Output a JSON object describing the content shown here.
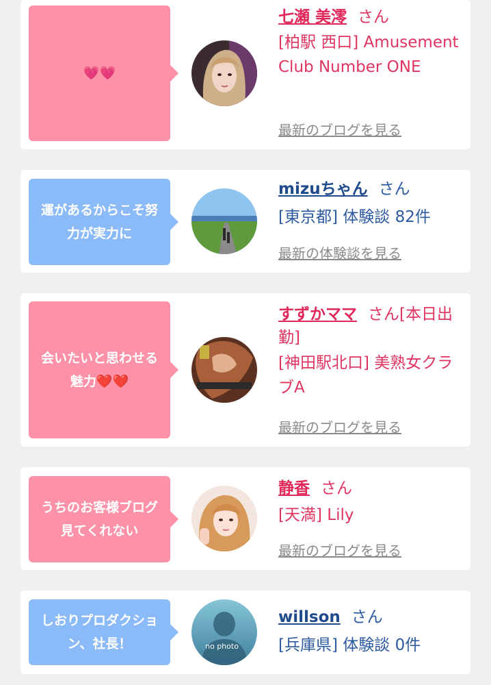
{
  "cards": [
    {
      "bubble_text": "💗💗",
      "name": "七瀬 美澪",
      "honorific": "さん",
      "shop": "[柏駅 西口] Amusement Club Number ONE",
      "link": "最新のブログを見る",
      "color": "pink"
    },
    {
      "bubble_text": "運があるからこそ努力が実力に",
      "name": "mizuちゃん",
      "honorific": "さん",
      "shop": "[東京都] 体験談 82件",
      "link": "最新の体験談を見る",
      "color": "blue"
    },
    {
      "bubble_text": "会いたいと思わせる魅力❤️❤️",
      "name": "すずかママ",
      "honorific": "さん[本日出勤]",
      "shop": "[神田駅北口] 美熟女クラブA",
      "link": "最新のブログを見る",
      "color": "pink"
    },
    {
      "bubble_text": "うちのお客様ブログ見てくれない",
      "name": "静香",
      "honorific": "さん",
      "shop": "[天満] Lily",
      "link": "最新のブログを見る",
      "color": "pink"
    },
    {
      "bubble_text": "しおりプロダクション、社長！",
      "name": "willson",
      "honorific": "さん",
      "shop": "[兵庫県] 体験談 0件",
      "link": "",
      "color": "blue",
      "avatar_text": "no photo"
    }
  ],
  "colors": {
    "pink_bubble": "#fd91a8",
    "blue_bubble": "#8bbaf8",
    "pink_text": "#e03460",
    "blue_text": "#2d5aa0"
  }
}
